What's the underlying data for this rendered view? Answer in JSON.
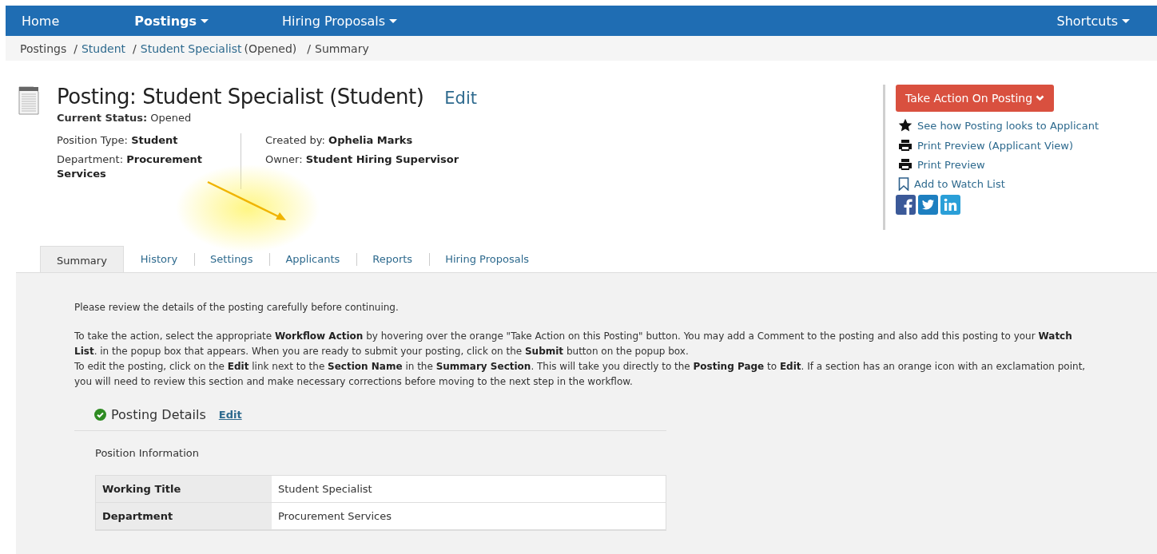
{
  "nav": {
    "items": [
      {
        "label": "Home",
        "selected": false,
        "dropdown": false
      },
      {
        "label": "Postings",
        "selected": true,
        "dropdown": true
      },
      {
        "label": "Hiring Proposals",
        "selected": false,
        "dropdown": true
      }
    ],
    "shortcuts": {
      "label": "Shortcuts",
      "dropdown": true
    }
  },
  "breadcrumb": [
    {
      "text": "Postings",
      "link": false
    },
    {
      "separator": "/",
      "text": "Student",
      "link": true
    },
    {
      "separator": "/",
      "text": "Student Specialist",
      "link": true,
      "suffix": "(Opened)"
    },
    {
      "separator": "/",
      "text": "Summary",
      "link": false
    }
  ],
  "header": {
    "title": "Posting: Student Specialist (Student)",
    "edit": "Edit",
    "status": {
      "label": "Current Status:",
      "value": "Opened"
    },
    "left_fields": [
      {
        "label": "Position Type:",
        "value": "Student"
      },
      {
        "label": "Department:",
        "value": "Procurement Services"
      }
    ],
    "right_fields": [
      {
        "label": "Created by:",
        "value": "Ophelia Marks"
      },
      {
        "label": "Owner:",
        "value": "Student Hiring Supervisor"
      }
    ]
  },
  "actions": {
    "button": "Take Action On Posting",
    "links": [
      {
        "kind": "star",
        "label": "See how Posting looks to Applicant"
      },
      {
        "kind": "print",
        "label": "Print Preview (Applicant View)"
      },
      {
        "kind": "print",
        "label": "Print Preview"
      },
      {
        "kind": "bookmark",
        "label": "Add to Watch List"
      }
    ],
    "social": [
      {
        "kind": "facebook"
      },
      {
        "kind": "twitter"
      },
      {
        "kind": "linkedin"
      }
    ]
  },
  "annotation": {
    "kind": "arrow"
  },
  "tabs": [
    {
      "label": "Summary",
      "selected": true
    },
    {
      "label": "History",
      "selected": false
    },
    {
      "label": "Settings",
      "selected": false
    },
    {
      "label": "Applicants",
      "selected": false
    },
    {
      "label": "Reports",
      "selected": false
    },
    {
      "label": "Hiring Proposals",
      "selected": false
    }
  ],
  "intro": "Please review the details of the posting carefully before continuing.",
  "instructions": [
    "To take the action, select the appropriate **Workflow Action** by hovering over the orange \"Take Action on this Posting\" button. You may add a Comment to the posting and also add this posting to your **Watch List**. in the popup box that appears. When you are ready to submit your posting, click on the **Submit** button on the popup box.",
    "To edit the posting, click on the **Edit** link next to the **Section Name** in the **Summary Section**. This will take you directly to the **Posting Page** to **Edit**. If a section has an orange icon with an exclamation point, you will need to review this section and make necessary corrections before moving to the next step in the workflow."
  ],
  "section": {
    "title": "Posting Details",
    "complete": true,
    "edit": "Edit",
    "subtitle": "Position Information",
    "rows": [
      {
        "label": "Working Title",
        "value": "Student Specialist"
      },
      {
        "label": "Department",
        "value": "Procurement Services"
      }
    ]
  }
}
